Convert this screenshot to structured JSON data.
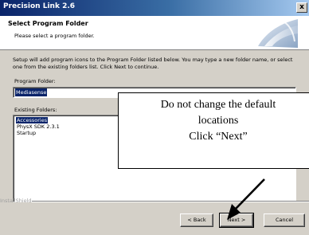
{
  "window": {
    "title": "Precision Link 2.6",
    "close_glyph": "x"
  },
  "header": {
    "title": "Select Program Folder",
    "subtitle": "Please select a program folder.",
    "graphic_icon": "wizard-swoosh-graphic"
  },
  "body": {
    "instructions": "Setup will add program icons to the Program Folder listed below. You may type a new folder name, or select one from the existing folders list. Click Next to continue.",
    "program_folder_label": "Program Folder:",
    "program_folder_value": "Mediasense",
    "existing_folders_label": "Existing Folders:",
    "existing_folders": [
      {
        "label": "Accessories",
        "selected": true
      },
      {
        "label": "PhysX SDK 2.3.1",
        "selected": false
      },
      {
        "label": "Startup",
        "selected": false
      }
    ]
  },
  "footer": {
    "brand": "InstallShield",
    "back_label": "< Back",
    "next_label": "Next >",
    "cancel_label": "Cancel"
  },
  "annotation": {
    "line1": "Do not change the default",
    "line2": "locations",
    "line3": "Click “Next”"
  },
  "colors": {
    "title_gradient_start": "#0a246a",
    "selection": "#0a246a",
    "dialog_face": "#d4d0c8"
  }
}
